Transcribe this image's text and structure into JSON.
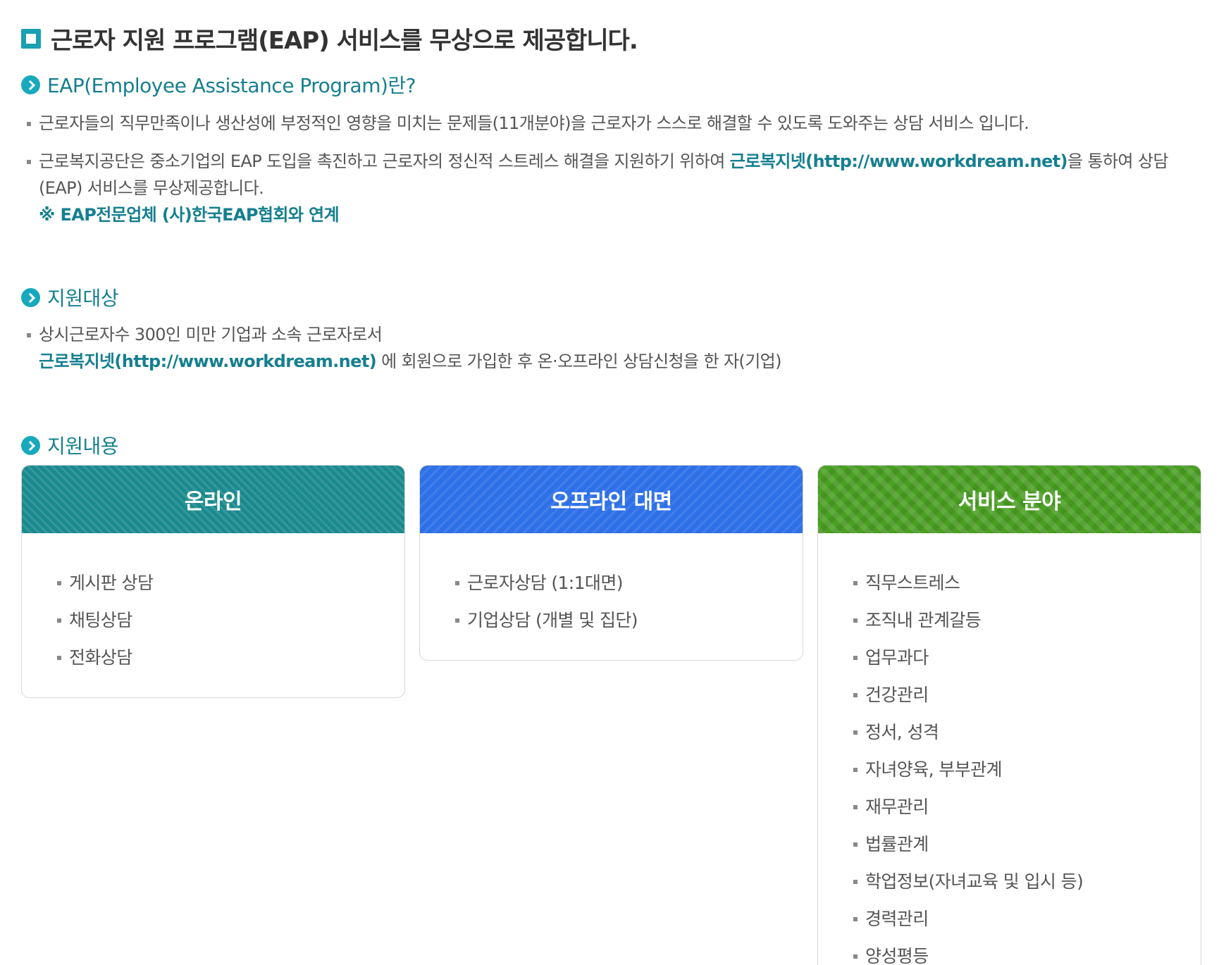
{
  "title": "근로자 지원 프로그램(EAP) 서비스를 무상으로 제공합니다.",
  "sections": [
    {
      "heading": "EAP(Employee Assistance Program)란?"
    },
    {
      "heading": "지원대상"
    },
    {
      "heading": "지원내용"
    }
  ],
  "eap": {
    "p1": "근로자들의 직무만족이나 생산성에 부정적인 영향을 미치는 문제들(11개분야)을 근로자가 스스로 해결할 수 있도록 도와주는 상담 서비스 입니다.",
    "p2_before": "근로복지공단은 중소기업의 EAP 도입을 촉진하고 근로자의 정신적 스트레스 해결을 지원하기 위하여 ",
    "p2_link": "근로복지넷(http://www.workdream.net)",
    "p2_after": "을 통하여 상담",
    "p2_line2": "(EAP) 서비스를 무상제공합니다.",
    "note": "※ EAP전문업체 (사)한국EAP협회와 연계"
  },
  "target": {
    "line1": "상시근로자수 300인 미만 기업과 소속 근로자로서",
    "link": "근로복지넷(http://www.workdream.net)",
    "line2_after": " 에 회원으로 가입한 후 온·오프라인 상담신청을 한 자(기업)"
  },
  "cards": {
    "online": {
      "title": "온라인",
      "items": [
        "게시판 상담",
        "채팅상담",
        "전화상담"
      ]
    },
    "offline": {
      "title": "오프라인 대면",
      "items": [
        "근로자상담 (1:1대면)",
        "기업상담 (개별 및 집단)"
      ]
    },
    "service": {
      "title": "서비스 분야",
      "items": [
        "직무스트레스",
        "조직내 관계갈등",
        "업무과다",
        "건강관리",
        "정서, 성격",
        "자녀양육, 부부관계",
        "재무관리",
        "법률관계",
        "학업정보(자녀교육 및 입시 등)",
        "경력관리",
        "양성평등"
      ]
    }
  }
}
